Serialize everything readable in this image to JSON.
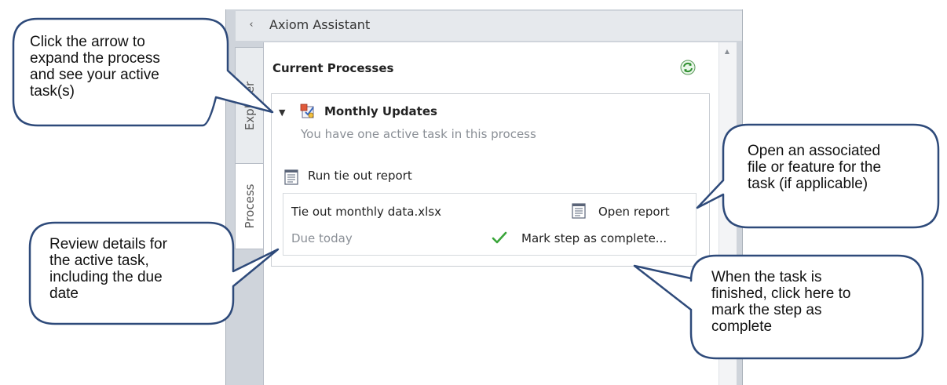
{
  "panel": {
    "title": "Axiom Assistant",
    "collapse_glyph": "‹",
    "tabs": [
      {
        "label": "Explorer"
      },
      {
        "label": "Process"
      }
    ]
  },
  "section": {
    "title": "Current Processes",
    "refresh_icon": "refresh-icon"
  },
  "process": {
    "name": "Monthly Updates",
    "description": "You have one active task in this process",
    "expand_glyph": "▼",
    "task": {
      "name": "Run tie out report",
      "file": "Tie out monthly data.xlsx",
      "open_label": "Open report",
      "due": "Due today",
      "complete_label": "Mark step as complete..."
    }
  },
  "callouts": {
    "expand": [
      "Click the arrow to",
      "expand the process",
      "and see your active",
      "task(s)"
    ],
    "details": [
      "Review details for",
      "the active task,",
      "including the due",
      "date"
    ],
    "open": [
      "Open an associated",
      "file or feature for the",
      "task (if applicable)"
    ],
    "complete": [
      "When the task is",
      "finished, click here to",
      "mark the step as",
      "complete"
    ]
  },
  "colors": {
    "callout_border": "#2e4a7a",
    "check": "#3aa53a",
    "refresh": "#3aa53a"
  }
}
